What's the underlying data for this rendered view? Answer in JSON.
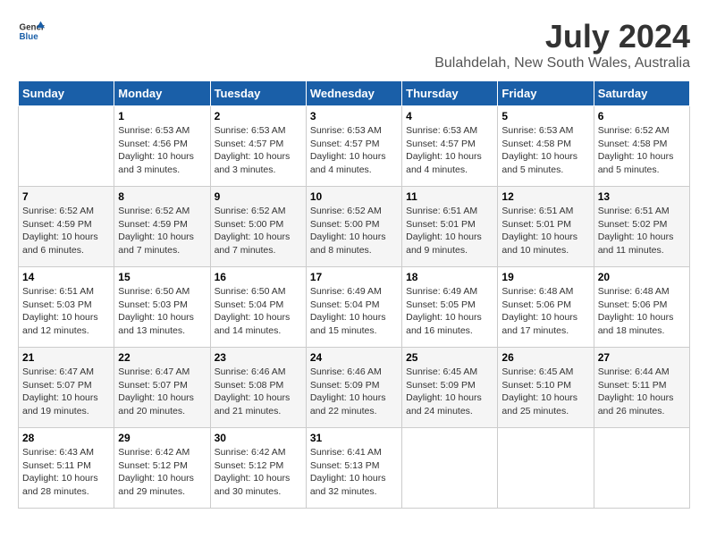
{
  "header": {
    "logo_line1": "General",
    "logo_line2": "Blue",
    "month": "July 2024",
    "location": "Bulahdelah, New South Wales, Australia"
  },
  "weekdays": [
    "Sunday",
    "Monday",
    "Tuesday",
    "Wednesday",
    "Thursday",
    "Friday",
    "Saturday"
  ],
  "weeks": [
    [
      {
        "day": "",
        "text": ""
      },
      {
        "day": "1",
        "text": "Sunrise: 6:53 AM\nSunset: 4:56 PM\nDaylight: 10 hours\nand 3 minutes."
      },
      {
        "day": "2",
        "text": "Sunrise: 6:53 AM\nSunset: 4:57 PM\nDaylight: 10 hours\nand 3 minutes."
      },
      {
        "day": "3",
        "text": "Sunrise: 6:53 AM\nSunset: 4:57 PM\nDaylight: 10 hours\nand 4 minutes."
      },
      {
        "day": "4",
        "text": "Sunrise: 6:53 AM\nSunset: 4:57 PM\nDaylight: 10 hours\nand 4 minutes."
      },
      {
        "day": "5",
        "text": "Sunrise: 6:53 AM\nSunset: 4:58 PM\nDaylight: 10 hours\nand 5 minutes."
      },
      {
        "day": "6",
        "text": "Sunrise: 6:52 AM\nSunset: 4:58 PM\nDaylight: 10 hours\nand 5 minutes."
      }
    ],
    [
      {
        "day": "7",
        "text": "Sunrise: 6:52 AM\nSunset: 4:59 PM\nDaylight: 10 hours\nand 6 minutes."
      },
      {
        "day": "8",
        "text": "Sunrise: 6:52 AM\nSunset: 4:59 PM\nDaylight: 10 hours\nand 7 minutes."
      },
      {
        "day": "9",
        "text": "Sunrise: 6:52 AM\nSunset: 5:00 PM\nDaylight: 10 hours\nand 7 minutes."
      },
      {
        "day": "10",
        "text": "Sunrise: 6:52 AM\nSunset: 5:00 PM\nDaylight: 10 hours\nand 8 minutes."
      },
      {
        "day": "11",
        "text": "Sunrise: 6:51 AM\nSunset: 5:01 PM\nDaylight: 10 hours\nand 9 minutes."
      },
      {
        "day": "12",
        "text": "Sunrise: 6:51 AM\nSunset: 5:01 PM\nDaylight: 10 hours\nand 10 minutes."
      },
      {
        "day": "13",
        "text": "Sunrise: 6:51 AM\nSunset: 5:02 PM\nDaylight: 10 hours\nand 11 minutes."
      }
    ],
    [
      {
        "day": "14",
        "text": "Sunrise: 6:51 AM\nSunset: 5:03 PM\nDaylight: 10 hours\nand 12 minutes."
      },
      {
        "day": "15",
        "text": "Sunrise: 6:50 AM\nSunset: 5:03 PM\nDaylight: 10 hours\nand 13 minutes."
      },
      {
        "day": "16",
        "text": "Sunrise: 6:50 AM\nSunset: 5:04 PM\nDaylight: 10 hours\nand 14 minutes."
      },
      {
        "day": "17",
        "text": "Sunrise: 6:49 AM\nSunset: 5:04 PM\nDaylight: 10 hours\nand 15 minutes."
      },
      {
        "day": "18",
        "text": "Sunrise: 6:49 AM\nSunset: 5:05 PM\nDaylight: 10 hours\nand 16 minutes."
      },
      {
        "day": "19",
        "text": "Sunrise: 6:48 AM\nSunset: 5:06 PM\nDaylight: 10 hours\nand 17 minutes."
      },
      {
        "day": "20",
        "text": "Sunrise: 6:48 AM\nSunset: 5:06 PM\nDaylight: 10 hours\nand 18 minutes."
      }
    ],
    [
      {
        "day": "21",
        "text": "Sunrise: 6:47 AM\nSunset: 5:07 PM\nDaylight: 10 hours\nand 19 minutes."
      },
      {
        "day": "22",
        "text": "Sunrise: 6:47 AM\nSunset: 5:07 PM\nDaylight: 10 hours\nand 20 minutes."
      },
      {
        "day": "23",
        "text": "Sunrise: 6:46 AM\nSunset: 5:08 PM\nDaylight: 10 hours\nand 21 minutes."
      },
      {
        "day": "24",
        "text": "Sunrise: 6:46 AM\nSunset: 5:09 PM\nDaylight: 10 hours\nand 22 minutes."
      },
      {
        "day": "25",
        "text": "Sunrise: 6:45 AM\nSunset: 5:09 PM\nDaylight: 10 hours\nand 24 minutes."
      },
      {
        "day": "26",
        "text": "Sunrise: 6:45 AM\nSunset: 5:10 PM\nDaylight: 10 hours\nand 25 minutes."
      },
      {
        "day": "27",
        "text": "Sunrise: 6:44 AM\nSunset: 5:11 PM\nDaylight: 10 hours\nand 26 minutes."
      }
    ],
    [
      {
        "day": "28",
        "text": "Sunrise: 6:43 AM\nSunset: 5:11 PM\nDaylight: 10 hours\nand 28 minutes."
      },
      {
        "day": "29",
        "text": "Sunrise: 6:42 AM\nSunset: 5:12 PM\nDaylight: 10 hours\nand 29 minutes."
      },
      {
        "day": "30",
        "text": "Sunrise: 6:42 AM\nSunset: 5:12 PM\nDaylight: 10 hours\nand 30 minutes."
      },
      {
        "day": "31",
        "text": "Sunrise: 6:41 AM\nSunset: 5:13 PM\nDaylight: 10 hours\nand 32 minutes."
      },
      {
        "day": "",
        "text": ""
      },
      {
        "day": "",
        "text": ""
      },
      {
        "day": "",
        "text": ""
      }
    ]
  ]
}
